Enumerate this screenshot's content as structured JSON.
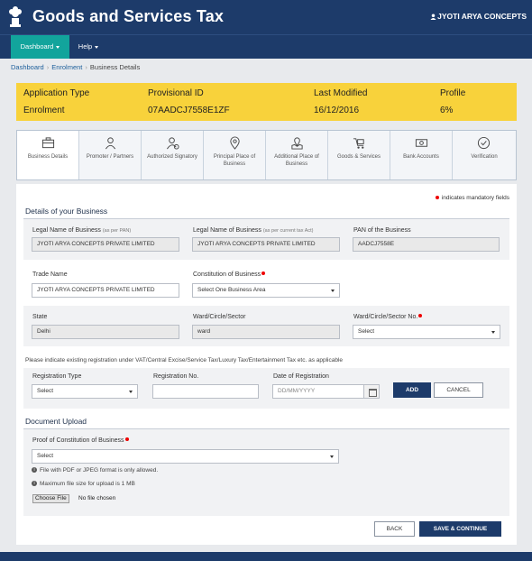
{
  "header": {
    "title": "Goods and Services Tax",
    "user": "JYOTI ARYA CONCEPTS"
  },
  "nav": {
    "dashboard": "Dashboard",
    "help": "Help"
  },
  "breadcrumb": [
    "Dashboard",
    "Enrolment",
    "Business Details"
  ],
  "application": {
    "type_label": "Application Type",
    "type_value": "Enrolment",
    "id_label": "Provisional ID",
    "id_value": "07AADCJ7558E1ZF",
    "modified_label": "Last Modified",
    "modified_value": "16/12/2016",
    "profile_label": "Profile",
    "profile_value": "6%"
  },
  "steps": [
    {
      "label": "Business Details",
      "icon": "briefcase-icon"
    },
    {
      "label": "Promoter / Partners",
      "icon": "person-icon"
    },
    {
      "label": "Authorized Signatory",
      "icon": "signatory-icon"
    },
    {
      "label": "Principal Place of Business",
      "icon": "location-pin-icon"
    },
    {
      "label": "Additional Place of Business",
      "icon": "map-location-icon"
    },
    {
      "label": "Goods & Services",
      "icon": "goods-cart-icon"
    },
    {
      "label": "Bank Accounts",
      "icon": "bank-cash-icon"
    },
    {
      "label": "Verification",
      "icon": "checkmark-circle-icon"
    }
  ],
  "form": {
    "mandatory_note": "indicates mandatory fields",
    "section_business": "Details of your Business",
    "legal_name_pan_label": "Legal Name of Business",
    "legal_name_pan_hint": "(as per PAN)",
    "legal_name_pan_value": "JYOTI ARYA CONCEPTS PRIVATE LIMITED",
    "legal_name_tax_label": "Legal Name of Business",
    "legal_name_tax_hint": "(as per current tax Act)",
    "legal_name_tax_value": "JYOTI ARYA CONCEPTS PRIVATE LIMITED",
    "pan_label": "PAN of the Business",
    "pan_value": "AADCJ7558E",
    "trade_name_label": "Trade Name",
    "trade_name_value": "JYOTI ARYA CONCEPTS PRIVATE LIMITED",
    "constitution_label": "Constitution of Business",
    "constitution_value": "Select One Business Area",
    "state_label": "State",
    "state_value": "Delhi",
    "ward_label": "Ward/Circle/Sector",
    "ward_value": "ward",
    "ward_no_label": "Ward/Circle/Sector No.",
    "ward_no_value": "Select",
    "existing_reg_note": "Please indicate existing registration under VAT/Central Excise/Service Tax/Luxury Tax/Entertainment Tax etc. as applicable",
    "reg_type_label": "Registration Type",
    "reg_type_value": "Select",
    "reg_no_label": "Registration No.",
    "reg_no_value": "",
    "reg_date_label": "Date of Registration",
    "reg_date_placeholder": "DD/MM/YYYY",
    "add_button": "ADD",
    "cancel_button": "CANCEL",
    "section_docs": "Document Upload",
    "proof_label": "Proof of Constitution of Business",
    "proof_value": "Select",
    "note_format": "File with PDF or JPEG format is only allowed.",
    "note_size": "Maximum file size for upload is 1 MB",
    "choose_file": "Choose File",
    "no_file": "No file chosen",
    "back_button": "BACK",
    "save_button": "SAVE & CONTINUE"
  }
}
